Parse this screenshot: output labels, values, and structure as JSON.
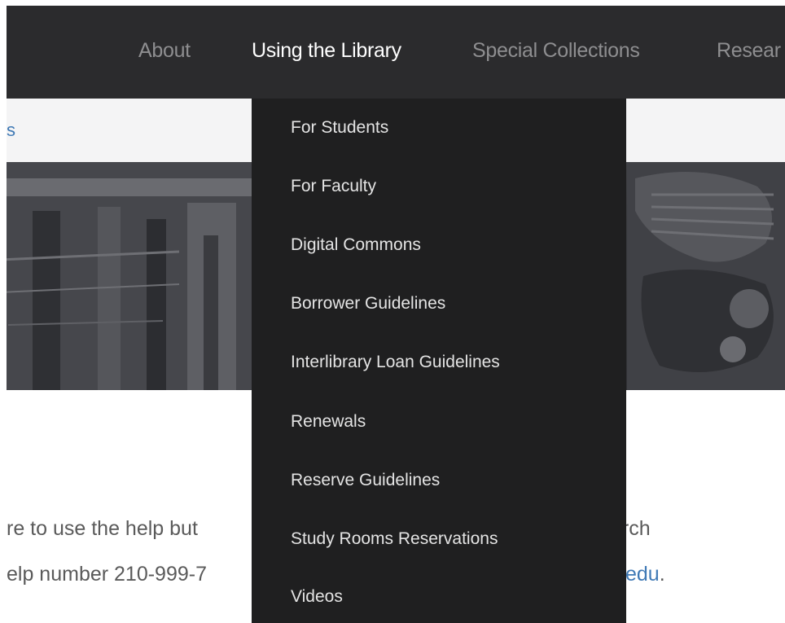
{
  "nav": {
    "items": [
      {
        "label": "About"
      },
      {
        "label": "Using the Library"
      },
      {
        "label": "Special Collections"
      },
      {
        "label": "Resear"
      }
    ],
    "active": "Using the Library"
  },
  "breadcrumb": {
    "link": "s"
  },
  "dropdown": {
    "items": [
      {
        "label": "For Students"
      },
      {
        "label": "For Faculty"
      },
      {
        "label": "Digital Commons"
      },
      {
        "label": "Borrower Guidelines"
      },
      {
        "label": "Interlibrary Loan Guidelines"
      },
      {
        "label": "Renewals"
      },
      {
        "label": "Reserve Guidelines"
      },
      {
        "label": "Study Rooms Reservations"
      },
      {
        "label": "Videos"
      }
    ]
  },
  "body": {
    "line1_left": "re to use the help but",
    "line1_right": "arch",
    "line2_left": "elp number 210-999-7",
    "line2_right_link": "edu",
    "line2_right_punct": "."
  },
  "colors": {
    "nav_bg": "#2b2b2d",
    "dropdown_bg": "#1f1f20",
    "link": "#3f79b5",
    "breadcrumb_bg": "#f4f4f5"
  }
}
